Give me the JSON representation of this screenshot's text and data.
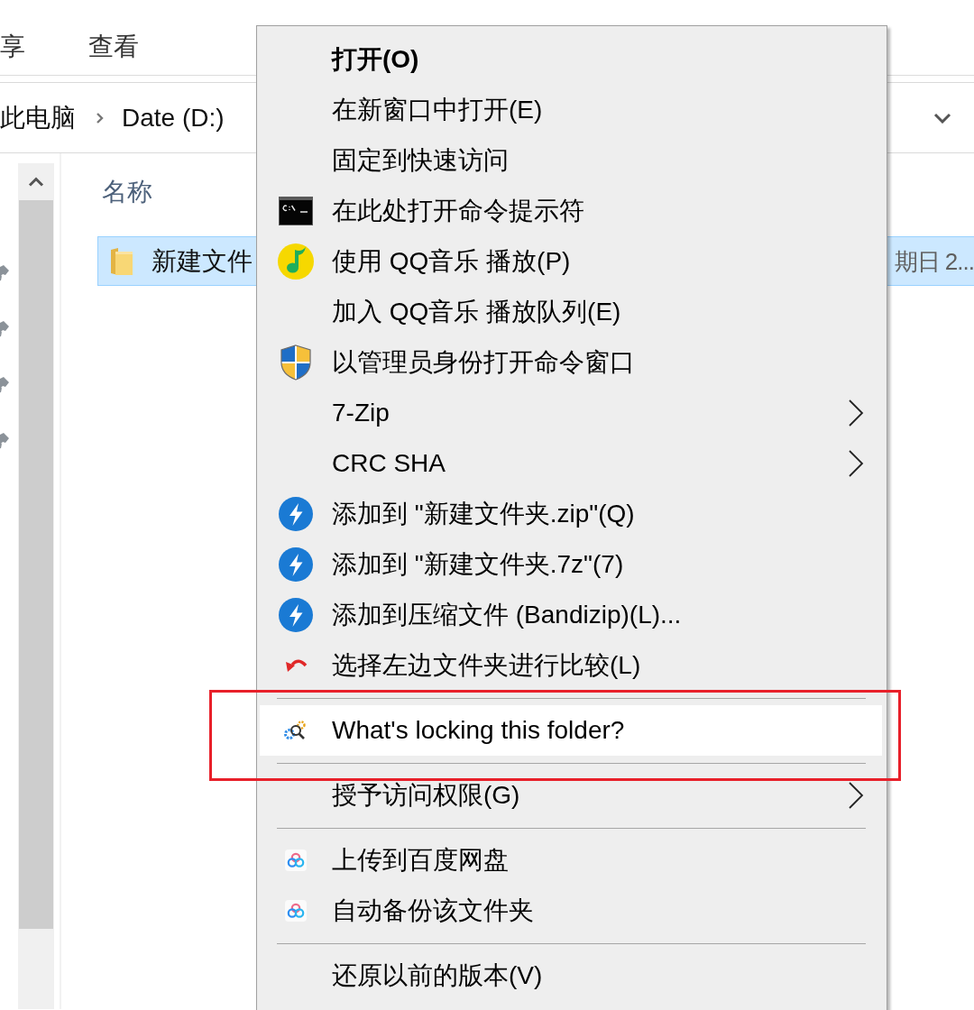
{
  "ribbon": {
    "tabs": [
      {
        "label": "享"
      },
      {
        "label": "查看"
      }
    ]
  },
  "address_bar": {
    "path": [
      "此电脑",
      "Date (D:)"
    ]
  },
  "file_list": {
    "columns": [
      "名称"
    ],
    "rows": [
      {
        "name": "新建文件",
        "column_2": "期日 2...",
        "selected": true
      }
    ]
  },
  "context_menu": {
    "items": [
      {
        "kind": "plain",
        "label": "打开(O)",
        "default": true,
        "submenu": false,
        "selected": false
      },
      {
        "kind": "plain",
        "label": "在新窗口中打开(E)",
        "default": false,
        "submenu": false,
        "selected": false
      },
      {
        "kind": "plain",
        "label": "固定到快速访问",
        "default": false,
        "submenu": false,
        "selected": false
      },
      {
        "kind": "terminal",
        "label": "在此处打开命令提示符",
        "default": false,
        "submenu": false,
        "selected": false
      },
      {
        "kind": "music",
        "label": "使用 QQ音乐 播放(P)",
        "default": false,
        "submenu": false,
        "selected": false
      },
      {
        "kind": "plain",
        "label": "加入 QQ音乐 播放队列(E)",
        "default": false,
        "submenu": false,
        "selected": false
      },
      {
        "kind": "shield",
        "label": "以管理员身份打开命令窗口",
        "default": false,
        "submenu": false,
        "selected": false
      },
      {
        "kind": "plain",
        "label": "7-Zip",
        "default": false,
        "submenu": true,
        "selected": false
      },
      {
        "kind": "plain",
        "label": "CRC SHA",
        "default": false,
        "submenu": true,
        "selected": false
      },
      {
        "kind": "archive",
        "label": "添加到 \"新建文件夹.zip\"(Q)",
        "default": false,
        "submenu": false,
        "selected": false
      },
      {
        "kind": "archive",
        "label": "添加到 \"新建文件夹.7z\"(7)",
        "default": false,
        "submenu": false,
        "selected": false
      },
      {
        "kind": "archive",
        "label": "添加到压缩文件 (Bandizip)(L)...",
        "default": false,
        "submenu": false,
        "selected": false
      },
      {
        "kind": "compare",
        "label": "选择左边文件夹进行比较(L)",
        "default": false,
        "submenu": false,
        "selected": false
      },
      {
        "kind": "separator"
      },
      {
        "kind": "inspect",
        "label": "What's locking this folder?",
        "default": false,
        "submenu": false,
        "selected": true
      },
      {
        "kind": "separator"
      },
      {
        "kind": "plain",
        "label": "授予访问权限(G)",
        "default": false,
        "submenu": true,
        "selected": false
      },
      {
        "kind": "separator"
      },
      {
        "kind": "cloud",
        "label": "上传到百度网盘",
        "default": false,
        "submenu": false,
        "selected": false
      },
      {
        "kind": "cloud",
        "label": "自动备份该文件夹",
        "default": false,
        "submenu": false,
        "selected": false
      },
      {
        "kind": "separator"
      },
      {
        "kind": "plain",
        "label": "还原以前的版本(V)",
        "default": false,
        "submenu": false,
        "selected": false
      }
    ]
  }
}
